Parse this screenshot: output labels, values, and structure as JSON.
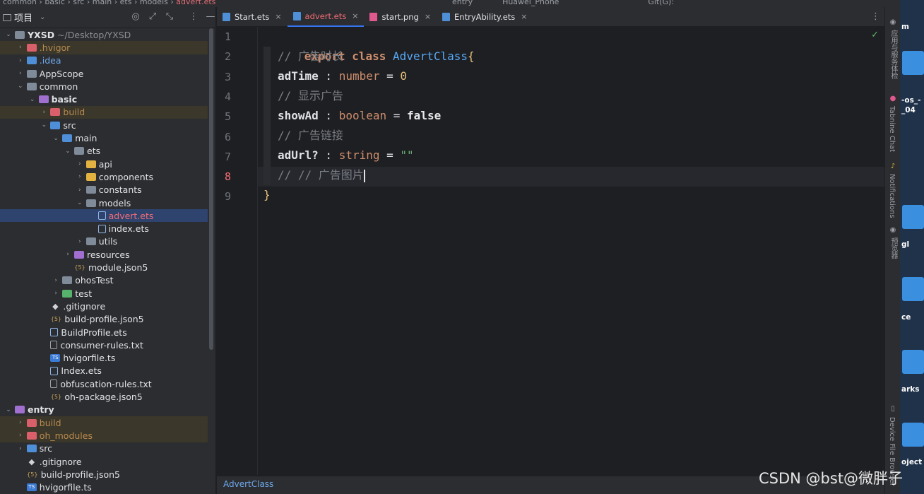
{
  "topbar": {
    "crumbs": [
      "common",
      "basic",
      "src",
      "main",
      "ets",
      "models"
    ],
    "active_file": "advert.ets",
    "run_config": "entry",
    "device": "Huawei_Phone",
    "vcs": "Git(G):"
  },
  "project_panel": {
    "title": "项目",
    "tree": [
      {
        "label": "YXSD",
        "path": "~/Desktop/YXSD",
        "depth": 0,
        "arrow": "down",
        "icon": "folder",
        "style": "bold"
      },
      {
        "label": ".hvigor",
        "depth": 1,
        "arrow": "right",
        "icon": "folder-red",
        "style": "dim",
        "excluded": true
      },
      {
        "label": ".idea",
        "depth": 1,
        "arrow": "right",
        "icon": "folder-blue",
        "style": "blue"
      },
      {
        "label": "AppScope",
        "depth": 1,
        "arrow": "right",
        "icon": "folder"
      },
      {
        "label": "common",
        "depth": 1,
        "arrow": "down",
        "icon": "folder"
      },
      {
        "label": "basic",
        "depth": 2,
        "arrow": "down",
        "icon": "folder-purple",
        "style": "bold"
      },
      {
        "label": "build",
        "depth": 3,
        "arrow": "right",
        "icon": "folder-red",
        "style": "dim",
        "excluded": true
      },
      {
        "label": "src",
        "depth": 3,
        "arrow": "down",
        "icon": "folder-blue"
      },
      {
        "label": "main",
        "depth": 4,
        "arrow": "down",
        "icon": "folder-blue"
      },
      {
        "label": "ets",
        "depth": 5,
        "arrow": "down",
        "icon": "folder"
      },
      {
        "label": "api",
        "depth": 6,
        "arrow": "right",
        "icon": "folder-yellow"
      },
      {
        "label": "components",
        "depth": 6,
        "arrow": "right",
        "icon": "folder-yellow"
      },
      {
        "label": "constants",
        "depth": 6,
        "arrow": "right",
        "icon": "folder"
      },
      {
        "label": "models",
        "depth": 6,
        "arrow": "down",
        "icon": "folder"
      },
      {
        "label": "advert.ets",
        "depth": 7,
        "arrow": "",
        "icon": "file",
        "style": "sel",
        "selected": true
      },
      {
        "label": "index.ets",
        "depth": 7,
        "arrow": "",
        "icon": "file"
      },
      {
        "label": "utils",
        "depth": 6,
        "arrow": "right",
        "icon": "folder"
      },
      {
        "label": "resources",
        "depth": 5,
        "arrow": "right",
        "icon": "folder-purple"
      },
      {
        "label": "module.json5",
        "depth": 5,
        "arrow": "",
        "icon": "json"
      },
      {
        "label": "ohosTest",
        "depth": 4,
        "arrow": "right",
        "icon": "folder"
      },
      {
        "label": "test",
        "depth": 4,
        "arrow": "right",
        "icon": "folder-green"
      },
      {
        "label": ".gitignore",
        "depth": 3,
        "arrow": "",
        "icon": "git"
      },
      {
        "label": "build-profile.json5",
        "depth": 3,
        "arrow": "",
        "icon": "json"
      },
      {
        "label": "BuildProfile.ets",
        "depth": 3,
        "arrow": "",
        "icon": "file"
      },
      {
        "label": "consumer-rules.txt",
        "depth": 3,
        "arrow": "",
        "icon": "txt"
      },
      {
        "label": "hvigorfile.ts",
        "depth": 3,
        "arrow": "",
        "icon": "ts"
      },
      {
        "label": "Index.ets",
        "depth": 3,
        "arrow": "",
        "icon": "file"
      },
      {
        "label": "obfuscation-rules.txt",
        "depth": 3,
        "arrow": "",
        "icon": "txt"
      },
      {
        "label": "oh-package.json5",
        "depth": 3,
        "arrow": "",
        "icon": "json"
      },
      {
        "label": "entry",
        "depth": 0,
        "arrow": "down",
        "icon": "folder-purple",
        "style": "bold"
      },
      {
        "label": "build",
        "depth": 1,
        "arrow": "right",
        "icon": "folder-red",
        "style": "dim",
        "excluded": true
      },
      {
        "label": "oh_modules",
        "depth": 1,
        "arrow": "right",
        "icon": "folder-red",
        "style": "dim",
        "excluded": true
      },
      {
        "label": "src",
        "depth": 1,
        "arrow": "right",
        "icon": "folder-blue"
      },
      {
        "label": ".gitignore",
        "depth": 1,
        "arrow": "",
        "icon": "git"
      },
      {
        "label": "build-profile.json5",
        "depth": 1,
        "arrow": "",
        "icon": "json"
      },
      {
        "label": "hvigorfile.ts",
        "depth": 1,
        "arrow": "",
        "icon": "ts"
      }
    ]
  },
  "editor": {
    "tabs": [
      {
        "label": "Start.ets",
        "icon": "ets",
        "active": false
      },
      {
        "label": "advert.ets",
        "icon": "ets",
        "active": true,
        "modified": true
      },
      {
        "label": "start.png",
        "icon": "png",
        "active": false
      },
      {
        "label": "EntryAbility.ets",
        "icon": "ets",
        "active": false
      }
    ],
    "line_numbers": [
      "1",
      "2",
      "3",
      "4",
      "5",
      "6",
      "7",
      "8",
      "9"
    ],
    "current_line": "8",
    "code": {
      "l1": {
        "kw": "export",
        "kw2": "class",
        "name": "AdvertClass",
        "brace": "{"
      },
      "l2": {
        "comment": "// 广告时长"
      },
      "l3": {
        "id": "adTime",
        "colon": " : ",
        "type": "number",
        "eq": " = ",
        "value": "0"
      },
      "l4": {
        "comment": "// 显示广告"
      },
      "l5": {
        "id": "showAd",
        "colon": " : ",
        "type": "boolean",
        "eq": " = ",
        "value": "false"
      },
      "l6": {
        "comment": "// 广告链接"
      },
      "l7": {
        "id": "adUrl?",
        "colon": " : ",
        "type": "string",
        "eq": " = ",
        "value": "\"\""
      },
      "l8": {
        "comment": "// // 广告图片"
      },
      "l9": {
        "brace": "}"
      }
    },
    "breadcrumb": "AdvertClass"
  },
  "right_tools": [
    "应用与服务体检",
    "Tabnine Chat",
    "Notifications",
    "预览器",
    "Device File Browser"
  ],
  "desktop_labels": [
    "m",
    "-os_-",
    "_04",
    "gl",
    "ce",
    "arks",
    "oject"
  ],
  "watermark": "CSDN @bst@微胖子",
  "colors": {
    "editor_bg": "#1e1f22",
    "panel_bg": "#2b2d30",
    "selection": "#2e436e",
    "accent": "#3574f0",
    "keyword": "#cf8e6d",
    "class_name": "#56a8f5",
    "comment": "#7a7e85"
  }
}
